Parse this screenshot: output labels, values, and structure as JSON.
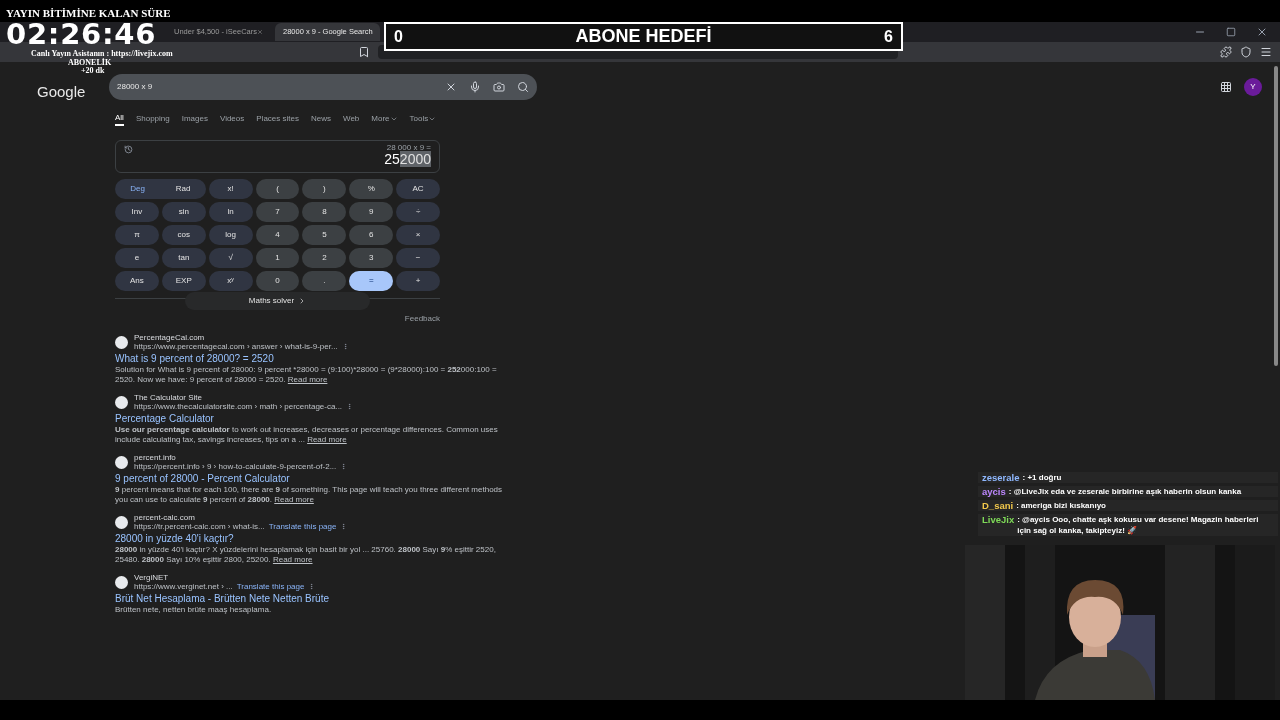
{
  "stream_overlay": {
    "timer_label": "YAYIN BİTİMİNE KALAN SÜRE",
    "timer": "02:26:46",
    "assistant": "Canlı Yayın Asistanın : https://livejix.com",
    "subscription": "ABONELİK",
    "bonus": "+20 dk"
  },
  "goal": {
    "current": "0",
    "title": "ABONE HEDEFİ",
    "target": "6"
  },
  "browser_tabs": [
    {
      "title": "Under $4,500 - iSeeCars",
      "selected": false
    },
    {
      "title": "28000 x 9 - Google Search",
      "selected": true
    }
  ],
  "logo": "Google",
  "search": {
    "value": "28000 x 9"
  },
  "avatar": "Y",
  "nav_tabs": [
    {
      "label": "All",
      "selected": true
    },
    {
      "label": "Shopping",
      "selected": false
    },
    {
      "label": "Images",
      "selected": false
    },
    {
      "label": "Videos",
      "selected": false
    },
    {
      "label": "Places sites",
      "selected": false
    },
    {
      "label": "News",
      "selected": false
    },
    {
      "label": "Web",
      "selected": false
    },
    {
      "label": "More",
      "selected": false,
      "menu": true
    },
    {
      "label": "Tools",
      "selected": false,
      "menu": true
    }
  ],
  "calculator": {
    "expression": "28 000 x 9 =",
    "result": "25",
    "result_selected": "2000",
    "angle_modes": [
      {
        "label": "Deg",
        "selected": true
      },
      {
        "label": "Rad",
        "selected": false
      }
    ],
    "keys": [
      {
        "label": "x!",
        "kind": "op"
      },
      {
        "label": "(",
        "kind": "num"
      },
      {
        "label": ")",
        "kind": "num"
      },
      {
        "label": "%",
        "kind": "num"
      },
      {
        "label": "AC",
        "kind": "op"
      },
      {
        "label": "Inv",
        "kind": "op"
      },
      {
        "label": "sin",
        "kind": "op"
      },
      {
        "label": "ln",
        "kind": "op"
      },
      {
        "label": "7",
        "kind": "num"
      },
      {
        "label": "8",
        "kind": "num"
      },
      {
        "label": "9",
        "kind": "num"
      },
      {
        "label": "÷",
        "kind": "op"
      },
      {
        "label": "π",
        "kind": "op"
      },
      {
        "label": "cos",
        "kind": "op"
      },
      {
        "label": "log",
        "kind": "op"
      },
      {
        "label": "4",
        "kind": "num"
      },
      {
        "label": "5",
        "kind": "num"
      },
      {
        "label": "6",
        "kind": "num"
      },
      {
        "label": "×",
        "kind": "op"
      },
      {
        "label": "e",
        "kind": "op"
      },
      {
        "label": "tan",
        "kind": "op"
      },
      {
        "label": "√",
        "kind": "op"
      },
      {
        "label": "1",
        "kind": "num"
      },
      {
        "label": "2",
        "kind": "num"
      },
      {
        "label": "3",
        "kind": "num"
      },
      {
        "label": "−",
        "kind": "op"
      },
      {
        "label": "Ans",
        "kind": "op"
      },
      {
        "label": "EXP",
        "kind": "op"
      },
      {
        "label": "xʸ",
        "kind": "op"
      },
      {
        "label": "0",
        "kind": "num"
      },
      {
        "label": ".",
        "kind": "num"
      },
      {
        "label": "=",
        "kind": "equals"
      },
      {
        "label": "+",
        "kind": "op"
      }
    ],
    "solver": "Maths solver",
    "feedback": "Feedback"
  },
  "results": [
    {
      "site": "PercentageCal.com",
      "url": "https://www.percentagecal.com › answer › what-is-9-per...",
      "title": "What is 9 percent of 28000? = 2520",
      "snippet": "Solution for What is 9 percent of 28000: 9 percent *28000 = (9:100)*28000 = (9*28000):100 = **252**000:100 = 2520. Now we have: 9 percent of 28000 = 2520.",
      "more": "Read more"
    },
    {
      "site": "The Calculator Site",
      "url": "https://www.thecalculatorsite.com › math › percentage-ca...",
      "title": "Percentage Calculator",
      "snippet": "**Use our percentage calculator** to work out increases, decreases or percentage differences. Common uses include calculating tax, savings increases, tips on a ...",
      "more": "Read more"
    },
    {
      "site": "percent.info",
      "url": "https://percent.info › 9 › how-to-calculate-9-percent-of-2...",
      "title": "9 percent of 28000 - Percent Calculator",
      "snippet": "**9** percent means that for each 100, there are **9** of something. This page will teach you three different methods you can use to calculate **9** percent of **28000**.",
      "more": "Read more"
    },
    {
      "site": "percent-calc.com",
      "url": "https://tr.percent-calc.com › what-is...",
      "translate": "Translate this page",
      "title": "28000 in yüzde 40'i kaçtır?",
      "snippet": "**28000** in yüzde 40'i kaçtır? X yüzdelerini hesaplamak için basit bir yol ... 25760. **28000** Sayı **9**% eşittir 2520, 25480. **28000** Sayı 10% eşittir 2800, 25200.",
      "more": "Read more"
    },
    {
      "site": "VergiNET",
      "url": "https://www.verginet.net › ...",
      "translate": "Translate this page",
      "title": "Brüt Net Hesaplama - Brütten Nete Netten Brüte",
      "snippet": "Brütten nete, netten brüte maaş hesaplama."
    }
  ],
  "chat": [
    {
      "user": "zeserale",
      "color": "#8fb8ff",
      "text": ": +1 doğru"
    },
    {
      "user": "aycis",
      "color": "#bb86fc",
      "text": ": @LiveJix eda ve zeserale birbirine aşık haberin olsun kanka"
    },
    {
      "user": "D_sani",
      "color": "#f2c84b",
      "text": ": ameriga bizi kıskanıyo"
    },
    {
      "user": "LiveJix",
      "color": "#7ed957",
      "text": ": @aycis Ooo, chatte aşk kokusu var desene! Magazin haberleri için sağ ol kanka, takipteyiz! 🚀"
    }
  ]
}
